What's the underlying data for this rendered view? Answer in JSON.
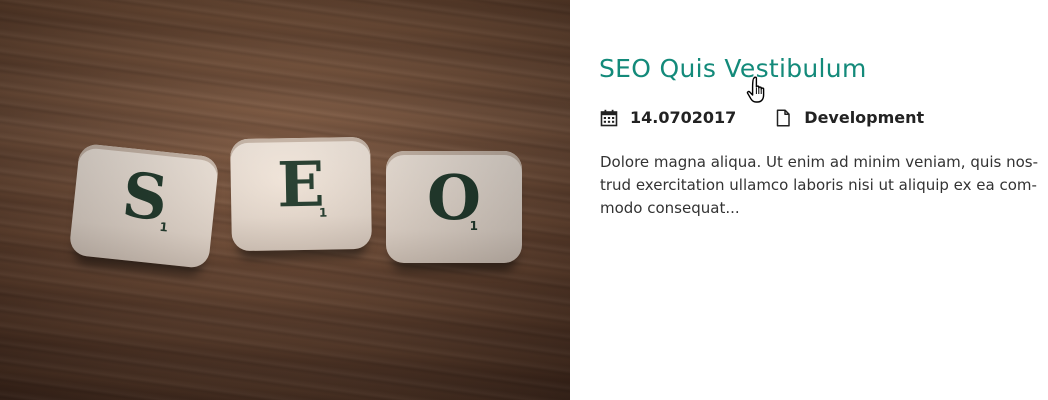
{
  "post": {
    "image_alt": "SEO",
    "tiles": [
      {
        "letter": "S",
        "points": "1"
      },
      {
        "letter": "E",
        "points": "1"
      },
      {
        "letter": "O",
        "points": "1"
      }
    ],
    "title": "SEO Quis Vestibulum",
    "date_icon": "calendar-icon",
    "date": "14.0702017",
    "category_icon": "document-icon",
    "category": "Development",
    "excerpt_lines": [
      "Dolore magna aliqua. Ut enim ad minim veniam, quis nos-",
      "trud exercitation ullamco laboris nisi ut aliquip ex ea com-",
      "modo consequat..."
    ]
  },
  "colors": {
    "title": "#138a7a",
    "tile_letter": "#143226"
  },
  "cursor_icon": "hand-pointer-icon"
}
